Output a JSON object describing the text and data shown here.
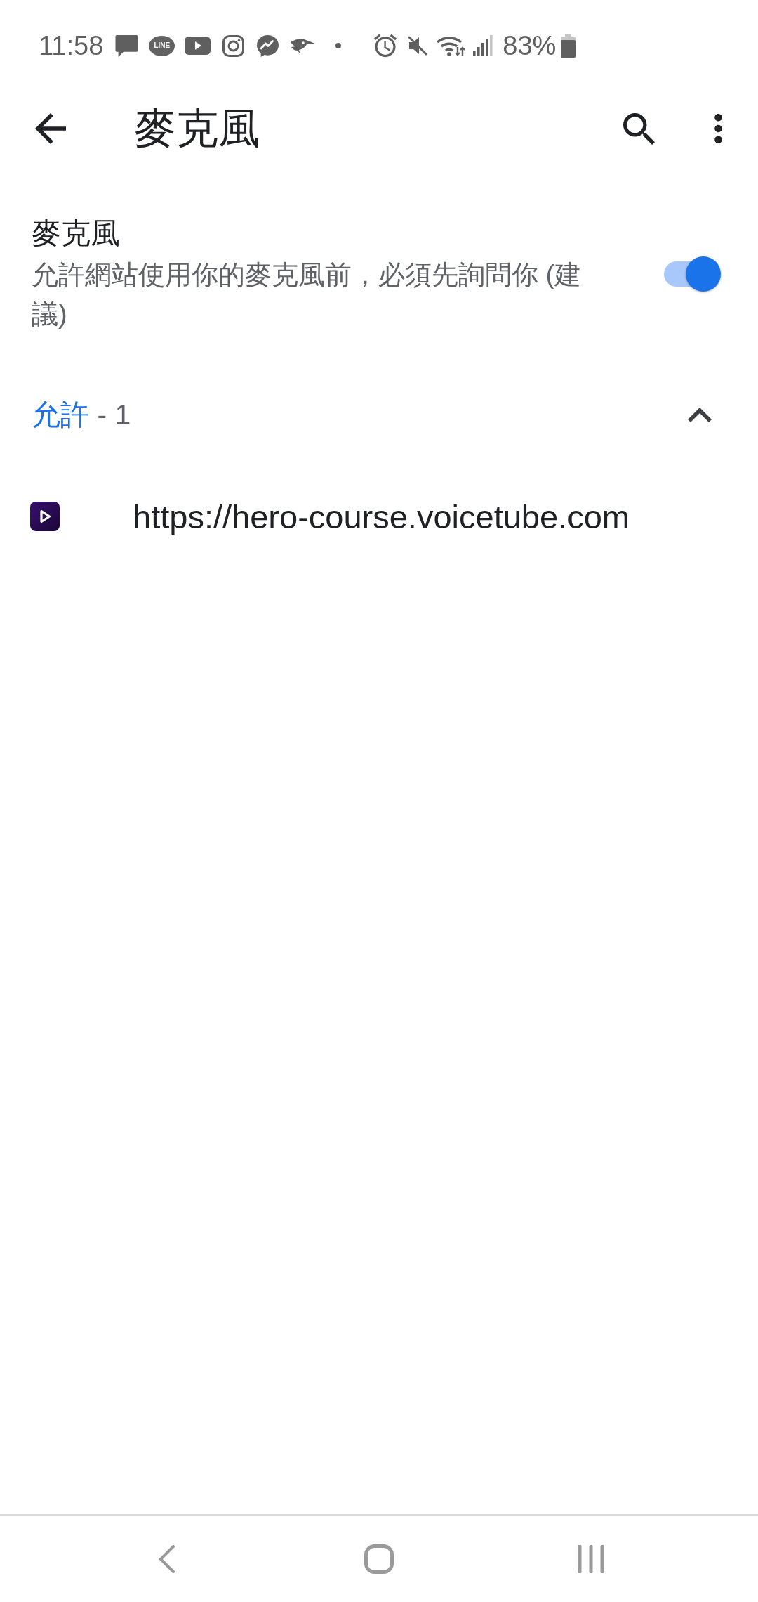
{
  "status_bar": {
    "time": "11:58",
    "chat_logo_text": "LINE",
    "battery": "83%"
  },
  "toolbar": {
    "title": "麥克風"
  },
  "setting": {
    "title": "麥克風",
    "description": "允許網站使用你的麥克風前，必須先詢問你 (建議)",
    "on": true
  },
  "allowed_section": {
    "label": "允許",
    "count": "- 1",
    "expanded": true,
    "sites": [
      {
        "url": "https://hero-course.voicetube.com"
      }
    ]
  }
}
